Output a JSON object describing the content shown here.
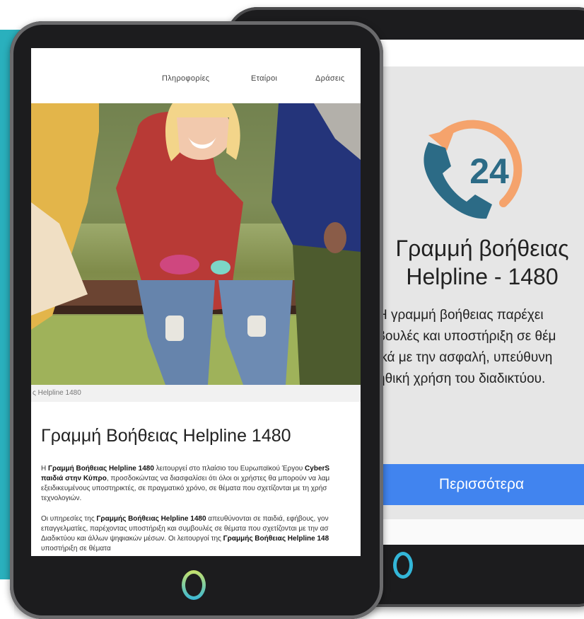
{
  "colors": {
    "teal_background": "#2ab0bd",
    "button_blue": "#4184ef",
    "phone_icon": "#2c6b86",
    "arrow_orange": "#f5a36c",
    "home_button": "#33b6d8"
  },
  "front_tablet": {
    "nav": [
      "Πληροφορίες",
      "Εταίροι",
      "Δράσεις"
    ],
    "hero_image": "people-sitting-on-bench-photo",
    "caption": "ς Helpline 1480",
    "article_title": "Γραμμή Βοήθειας Helpline 1480",
    "paragraph1": {
      "line1_start": "Η ",
      "line1_bold": "Γραμμή Βοήθειας Helpline 1480",
      "line1_rest": " λειτουργεί στο πλαίσιο του Ευρωπαϊκού Έργου ",
      "line1_bold2": "CyberS",
      "line2_bold": "παιδιά στην Κύπρο",
      "line2_rest": ", προσδοκώντας να διασφαλίσει ότι όλοι οι χρήστες θα μπορούν να λαμ",
      "line3": "εξειδικευμένους υποστηρικτές, σε πραγματικό χρόνο, σε θέματα που σχετίζονται με τη χρήσ",
      "line4": "τεχνολογιών."
    },
    "paragraph2": {
      "line1_start": "Οι υπηρεσίες της ",
      "line1_bold": "Γραμμής Βοήθειας Helpline 1480",
      "line1_rest": " απευθύνονται σε παιδιά, εφήβους, γον",
      "line2": "επαγγελματίες, παρέχοντας υποστήριξη και συμβουλές σε θέματα που σχετίζονται με την ασ",
      "line3_start": "Διαδικτύου και άλλων ψηφιακών μέσων. Οι λειτουργοί της ",
      "line3_bold": "Γραμμής Βοήθειας Helpline 148",
      "line4": "υποστήριξη σε θέματα"
    }
  },
  "back_tablet": {
    "icon": "24h-phone-icon",
    "icon_number": "24",
    "title_line1": "Γραμμή βοήθειας",
    "title_line2": "Helpline - 1480",
    "desc": [
      "Η γραμμή βοήθειας παρέχει",
      "βουλές και υποστήριξη σε θέμ",
      "ικά με την ασφαλή, υπεύθυνη",
      "ηθική χρήση του διαδικτύου."
    ],
    "button_label": "Περισσότερα"
  }
}
